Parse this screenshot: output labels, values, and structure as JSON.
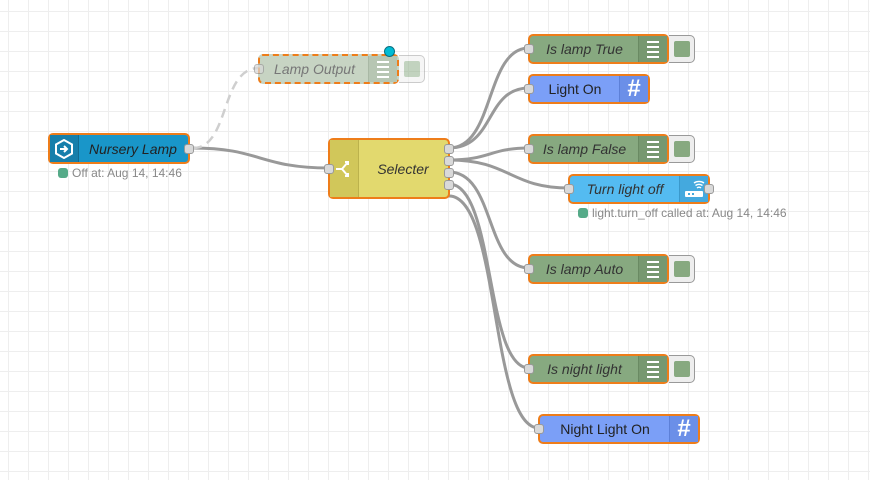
{
  "colors": {
    "selected_border": "#ee7d1a",
    "debug_fill": "#87a980",
    "template_fill": "#7b9ff7",
    "ha_input_fill": "#1996c9",
    "ha_service_fill": "#54bbf1",
    "switch_fill": "#e2d96e",
    "status_green": "#5a8",
    "wire": "#999999"
  },
  "nodes": {
    "nursery_lamp": {
      "label": "Nursery Lamp",
      "icon": "arrow-in-icon",
      "status": "Off at: Aug 14, 14:46"
    },
    "lamp_output": {
      "label": "Lamp Output",
      "icon": "list-icon",
      "disabled": true
    },
    "selecter": {
      "label": "Selecter",
      "icon": "switch-icon"
    },
    "is_lamp_true": {
      "label": "Is lamp True",
      "icon": "list-icon"
    },
    "light_on": {
      "label": "Light On",
      "icon": "hash-icon"
    },
    "is_lamp_false": {
      "label": "Is lamp False",
      "icon": "list-icon"
    },
    "turn_light_off": {
      "label": "Turn light off",
      "icon": "router-icon",
      "status": "light.turn_off called at: Aug 14, 14:46"
    },
    "is_lamp_auto": {
      "label": "Is lamp Auto",
      "icon": "list-icon"
    },
    "is_night_light": {
      "label": "Is night light",
      "icon": "list-icon"
    },
    "night_light_on": {
      "label": "Night Light On",
      "icon": "hash-icon"
    }
  }
}
